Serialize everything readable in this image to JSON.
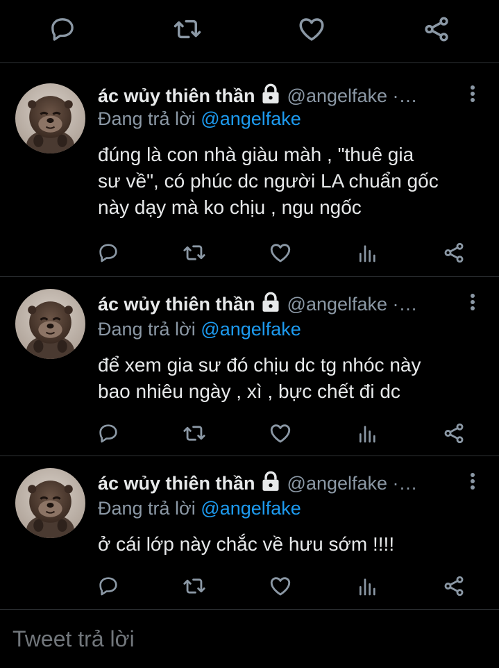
{
  "top_actions": [
    "reply-icon",
    "retweet-icon",
    "like-icon",
    "share-icon"
  ],
  "tweets": [
    {
      "name": "ác wủy thiên thần",
      "handle": "@angelfake ·…",
      "replying_prefix": "Đang trả lời",
      "replying_to": "@angelfake",
      "lines": [
        "đúng là con nhà giàu màh , \"thuê gia",
        "sư về\", có phúc dc người LA chuẩn gốc",
        "này dạy mà ko chịu , ngu ngốc"
      ]
    },
    {
      "name": "ác wủy thiên thần",
      "handle": "@angelfake ·…",
      "replying_prefix": "Đang trả lời",
      "replying_to": "@angelfake",
      "lines": [
        "để xem gia sư đó chịu dc tg nhóc này",
        "bao nhiêu ngày , xì , bực chết đi dc"
      ]
    },
    {
      "name": "ác wủy thiên thần",
      "handle": "@angelfake ·…",
      "replying_prefix": "Đang trả lời",
      "replying_to": "@angelfake",
      "lines": [
        "ở cái lớp này chắc về hưu sớm !!!!"
      ]
    }
  ],
  "reply_box": {
    "placeholder": "Tweet trả lời"
  },
  "colors": {
    "background": "#000000",
    "text": "#e7e9ea",
    "muted": "#8b98a5",
    "link": "#1d9bf0",
    "divider": "#2f3336"
  }
}
